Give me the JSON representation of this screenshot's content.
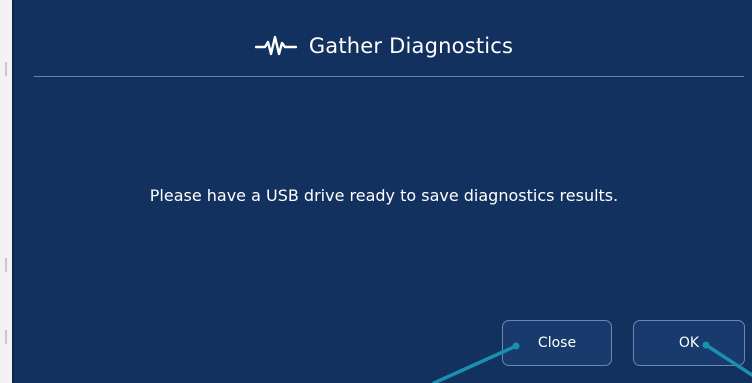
{
  "dialog": {
    "title": "Gather Diagnostics",
    "title_icon": "pulse-waveform-icon",
    "message": "Please have a USB drive ready to save diagnostics results.",
    "buttons": {
      "close_label": "Close",
      "ok_label": "OK"
    }
  },
  "colors": {
    "dialog_background": "#12315e",
    "button_background": "#183a6c",
    "button_border": "#6b86b0",
    "callout_line": "#1a8fb0"
  }
}
